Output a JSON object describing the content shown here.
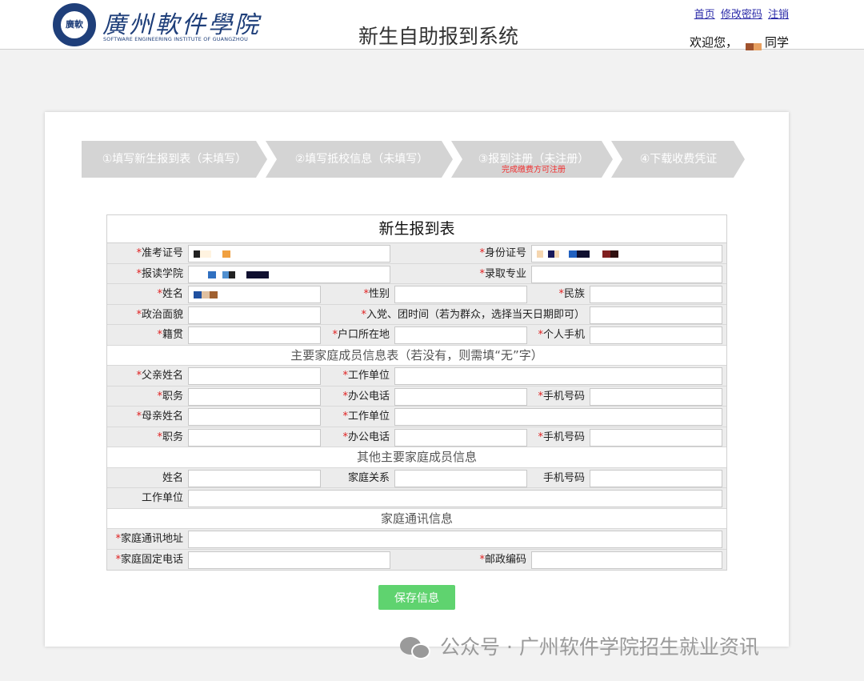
{
  "header": {
    "logo": {
      "seal_text": "廣軟",
      "name_cn": "廣州軟件學院",
      "name_en": "SOFTWARE ENGINEERING INSTITUTE OF GUANGZHOU"
    },
    "system_title": "新生自助报到系统",
    "links": {
      "home": "首页",
      "change_password": "修改密码",
      "logout": "注销"
    },
    "welcome_prefix": "欢迎您，",
    "welcome_suffix": "同学"
  },
  "steps": [
    {
      "label": "①填写新生报到表（未填写）",
      "sub": ""
    },
    {
      "label": "②填写抵校信息（未填写）",
      "sub": ""
    },
    {
      "label": "③报到注册（未注册）",
      "sub": "完成缴费方可注册"
    },
    {
      "label": "④下载收费凭证",
      "sub": ""
    }
  ],
  "colors": {
    "step_bg": "#d4d4d4",
    "required": "#e02020",
    "save_button": "#5fd36f",
    "link": "#2a2aa8"
  },
  "form": {
    "title": "新生报到表",
    "labels": {
      "exam_no": "准考证号",
      "id_no": "身份证号",
      "college": "报读学院",
      "major": "录取专业",
      "name": "姓名",
      "gender": "性别",
      "ethnicity": "民族",
      "political": "政治面貌",
      "join_date": "入党、团时间（若为群众，选择当天日期即可）",
      "native": "籍贯",
      "hukou": "户口所在地",
      "mobile": "个人手机",
      "father_name": "父亲姓名",
      "workplace": "工作单位",
      "duty": "职务",
      "office_phone": "办公电话",
      "phone": "手机号码",
      "mother_name": "母亲姓名",
      "member_name": "姓名",
      "relation": "家庭关系",
      "home_address": "家庭通讯地址",
      "home_phone": "家庭固定电话",
      "postcode": "邮政编码"
    },
    "sections": {
      "family": "主要家庭成员信息表（若没有，则需填“无”字）",
      "others": "其他主要家庭成员信息",
      "contact": "家庭通讯信息"
    },
    "required_mark": "*"
  },
  "save_button": "保存信息",
  "watermark": "公众号 · 广州软件学院招生就业资讯"
}
